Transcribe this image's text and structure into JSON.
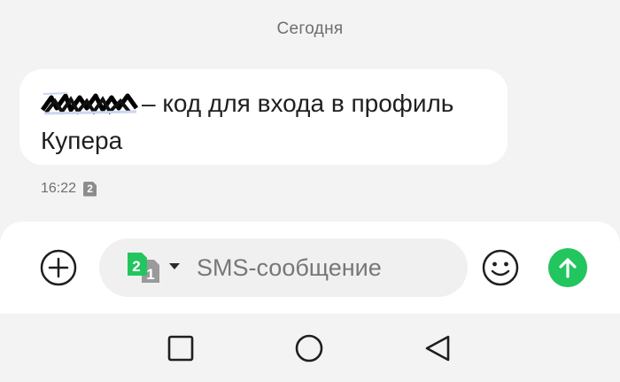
{
  "conversation": {
    "date_header": "Сегодня",
    "message": {
      "text": "– код для входа в профиль Купера",
      "time": "16:22",
      "sim_badge": "2"
    }
  },
  "composer": {
    "add_icon": "plus-circle-icon",
    "sim_selector": {
      "primary": "2",
      "secondary": "1"
    },
    "placeholder": "SMS-сообщение",
    "emoji_icon": "smiley-icon",
    "send_icon": "arrow-up-icon",
    "accent_color": "#22c55e"
  },
  "navigation": {
    "items": [
      {
        "name": "back",
        "icon": "triangle-left-icon"
      },
      {
        "name": "home",
        "icon": "circle-icon"
      },
      {
        "name": "recents",
        "icon": "square-icon"
      }
    ]
  }
}
